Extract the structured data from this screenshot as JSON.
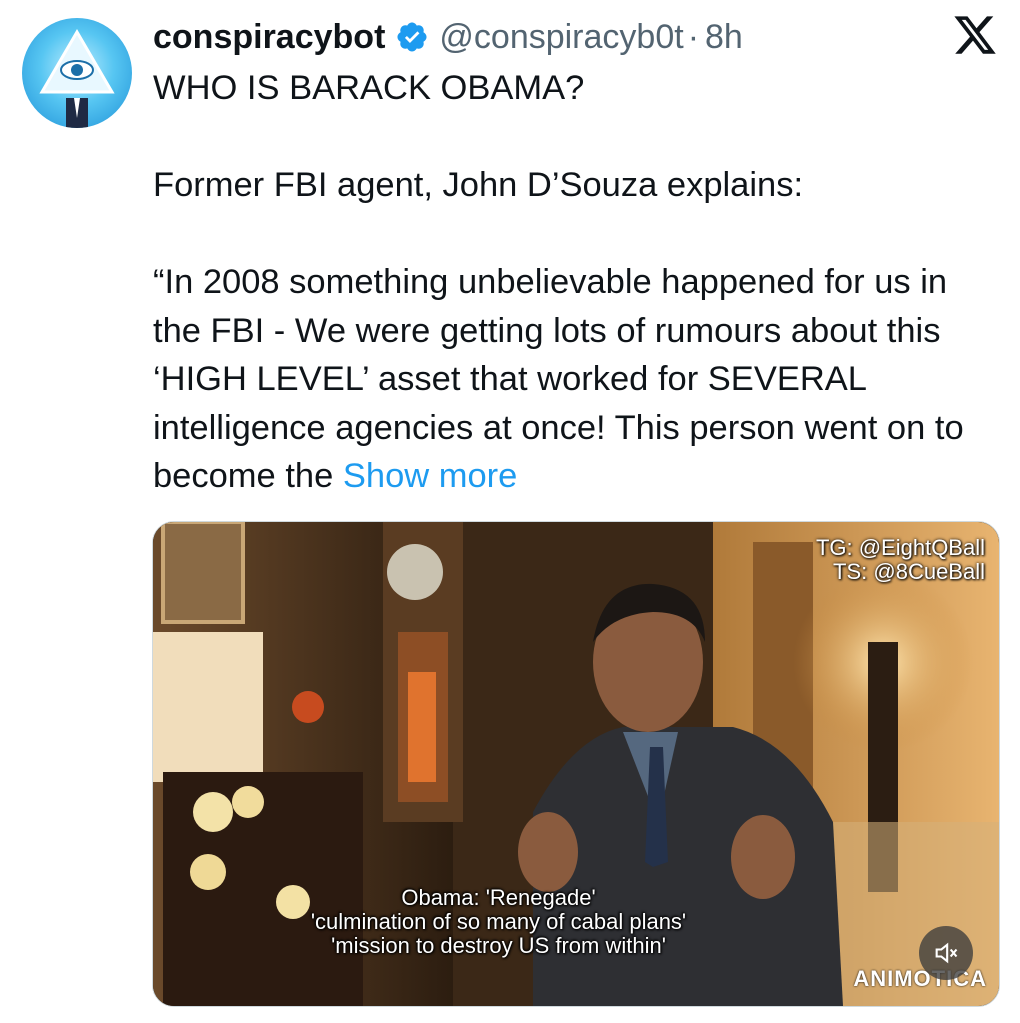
{
  "tweet": {
    "display_name": "conspiracybot",
    "handle": "@conspiracyb0t",
    "separator": "·",
    "time": "8h",
    "lines": {
      "l1": "WHO IS BARACK OBAMA?",
      "l2": "Former FBI agent, John D’Souza explains:",
      "l3": "“In 2008 something unbelievable happened for us in the FBI - We were getting lots of rumours about this ‘HIGH LEVEL’ asset that worked for SEVERAL intelligence agencies at once! This person went on to become the "
    },
    "show_more": "Show more"
  },
  "media": {
    "overlay_line1": "TG: @EightQBall",
    "overlay_line2": "TS: @8CueBall",
    "caption_line1": "Obama: 'Renegade'",
    "caption_line2": "'culmination of so many of cabal plans'",
    "caption_line3": "'mission to destroy US from within'",
    "watermark": "ANIMOTICA"
  },
  "icons": {
    "verified": "verified-badge-icon",
    "x_logo": "x-logo-icon",
    "mute": "volume-muted-icon"
  },
  "colors": {
    "link": "#1d9bf0",
    "verified": "#1d9bf0",
    "secondary_text": "#536471"
  }
}
